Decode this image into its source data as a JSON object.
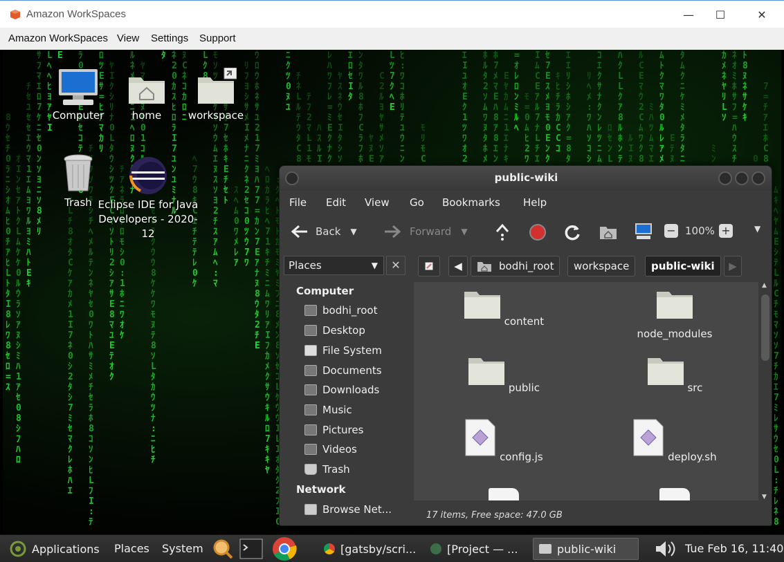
{
  "host": {
    "title": "Amazon WorkSpaces",
    "menu": [
      "Amazon WorkSpaces",
      "View",
      "Settings",
      "Support"
    ],
    "controls": {
      "minimize": "—",
      "maximize": "☐",
      "close": "✕"
    }
  },
  "desktop": {
    "icons": [
      {
        "label": "Computer",
        "icon": "computer-icon"
      },
      {
        "label": "home",
        "icon": "home-folder-icon"
      },
      {
        "label": "workspace",
        "icon": "folder-link-icon"
      },
      {
        "label": "Trash",
        "icon": "trash-icon"
      },
      {
        "label": "Eclipse IDE for Java Developers - 2020-12",
        "icon": "eclipse-icon"
      }
    ]
  },
  "file_manager": {
    "title": "public-wiki",
    "menu": [
      "File",
      "Edit",
      "View",
      "Go",
      "Bookmarks",
      "Help"
    ],
    "toolbar": {
      "back": "Back",
      "forward": "Forward",
      "zoom": "100%"
    },
    "places_label": "Places",
    "breadcrumbs": [
      "bodhi_root",
      "workspace",
      "public-wiki"
    ],
    "sidebar": {
      "computer_heading": "Computer",
      "computer_items": [
        "bodhi_root",
        "Desktop",
        "File System",
        "Documents",
        "Downloads",
        "Music",
        "Pictures",
        "Videos",
        "Trash"
      ],
      "network_heading": "Network",
      "network_items": [
        "Browse Net..."
      ]
    },
    "files": [
      {
        "name": "content",
        "type": "folder"
      },
      {
        "name": "node_modules",
        "type": "folder"
      },
      {
        "name": "public",
        "type": "folder"
      },
      {
        "name": "src",
        "type": "folder"
      },
      {
        "name": "config.js",
        "type": "script"
      },
      {
        "name": "deploy.sh",
        "type": "script"
      }
    ],
    "status": "17 items, Free space: 47.0 GB"
  },
  "taskbar": {
    "applications": "Applications",
    "places": "Places",
    "system": "System",
    "windows": [
      {
        "label": "[gatsby/scri...",
        "active": false
      },
      {
        "label": "[Project — ...",
        "active": false
      },
      {
        "label": "public-wiki",
        "active": true
      }
    ],
    "clock": "Tue Feb 16, 11:40"
  },
  "colors": {
    "matrix_green": "#22dd33",
    "window_bg": "#3b3b3b",
    "stop_red": "#d32f2f"
  }
}
